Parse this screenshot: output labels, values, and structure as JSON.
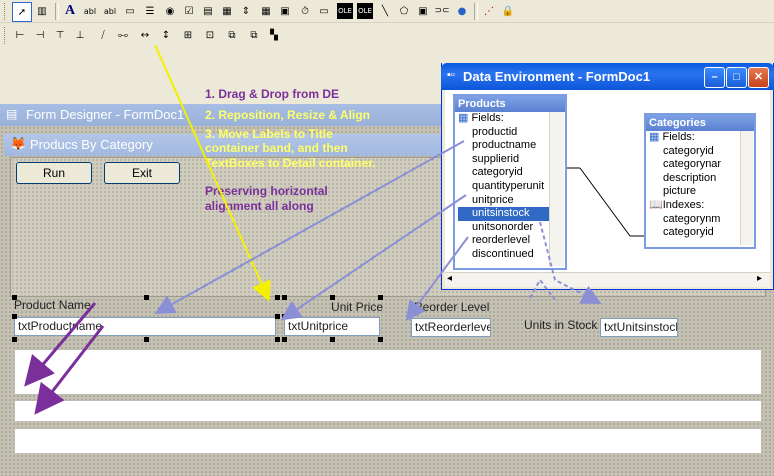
{
  "form_designer": {
    "window_title": "Form Designer - FormDoc1",
    "form_caption": "Producs By Category",
    "run_label": "Run",
    "exit_label": "Exit",
    "labels": {
      "product_name": "Product Name",
      "unit_price": "Unit Price",
      "reorder_level": "Reorder Level",
      "units_in_stock": "Units in Stock"
    },
    "textboxes": {
      "product_name": "txtProductname",
      "unit_price": "txtUnitprice",
      "reorder_level": "txtReorderleve",
      "units_in_stock": "txtUnitsinstock"
    }
  },
  "data_environment": {
    "window_title": "Data Environment - FormDoc1",
    "products": {
      "title": "Products",
      "fields_label": "Fields:",
      "fields": [
        "productid",
        "productname",
        "supplierid",
        "categoryid",
        "quantityperunit",
        "unitprice",
        "unitsinstock",
        "unitsonorder",
        "reorderlevel",
        "discontinued"
      ],
      "selected": "unitsinstock"
    },
    "categories": {
      "title": "Categories",
      "fields_label": "Fields:",
      "fields": [
        "categoryid",
        "categorynar",
        "description",
        "picture"
      ],
      "indexes_label": "Indexes:",
      "indexes": [
        "categorynm",
        "categoryid"
      ]
    }
  },
  "annotations": {
    "step1": "1. Drag & Drop from DE",
    "step2": "2. Reposition, Resize & Align",
    "step3_line1": "3. Move Labels to Title",
    "step3_line2": "container band, and then",
    "step3_line3": "TextBoxes  to Detail container.",
    "note_line1": "Preserving horizontal",
    "note_line2": "alignment all along"
  },
  "colors": {
    "annotation_purple": "#7b2f9a",
    "annotation_yellow": "#ffff66",
    "drag_arrow": "#8b8fd6",
    "yellow_arrow": "#f4f000"
  },
  "icons": {
    "toolbar_row1": [
      "pointer-icon",
      "view-classes-icon",
      "label-icon",
      "textbox-icon",
      "editbox-icon",
      "commandbutton-icon",
      "commandgroup-icon",
      "optiongroup-icon",
      "checkbox-icon",
      "combobox-icon",
      "listbox-icon",
      "spinner-icon",
      "grid-icon",
      "image-icon",
      "timer-icon",
      "pageframe-icon",
      "oleboundcontrol-icon",
      "olecontainer-icon",
      "line-icon",
      "shape-icon",
      "container-icon",
      "separator-icon",
      "hyperlink-icon",
      "builder-icon",
      "lock-icon"
    ],
    "toolbar_row2": [
      "align-left-icon",
      "align-right-icon",
      "align-top-icon",
      "align-bottom-icon",
      "center-vertical-icon",
      "center-horizontal-icon",
      "same-width-icon",
      "same-height-icon",
      "same-size-icon",
      "center-form-icon",
      "bring-front-icon",
      "send-back-icon"
    ]
  }
}
